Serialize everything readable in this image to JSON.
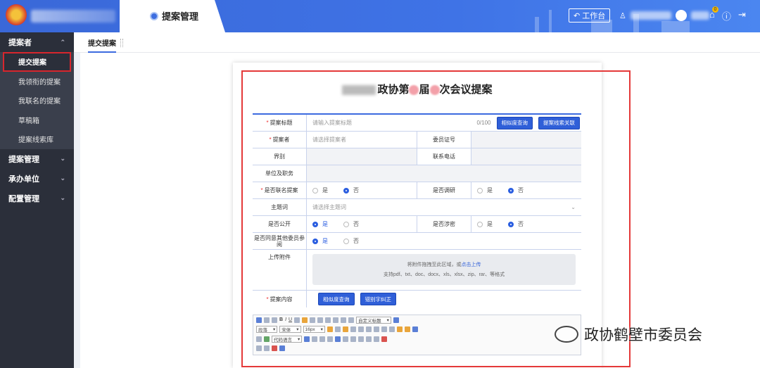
{
  "header": {
    "module_title": "提案管理",
    "workbench_label": "工作台",
    "notification_count": "0"
  },
  "sidebar": {
    "groups": [
      {
        "label": "提案者",
        "items": [
          "提交提案",
          "我领衔的提案",
          "我联名的提案",
          "草稿箱",
          "提案线索库"
        ]
      },
      {
        "label": "提案管理"
      },
      {
        "label": "承办单位"
      },
      {
        "label": "配置管理"
      }
    ]
  },
  "tabs": [
    "提交提案"
  ],
  "form": {
    "title_mid": "政协第",
    "title_mid2": "届",
    "title_end": "次会议提案",
    "fields": {
      "title_label": "提案标题",
      "title_placeholder": "请输入提案标题",
      "title_count": "0/100",
      "btn_similar": "相似度查询",
      "btn_clue": "提案线索关联",
      "proposer_label": "提案者",
      "proposer_placeholder": "请选择提案者",
      "member_no_label": "委员证号",
      "sector_label": "界别",
      "phone_label": "联系电话",
      "unit_label": "单位及职务",
      "joint_label": "是否联名提案",
      "research_label": "是否调研",
      "yes": "是",
      "no": "否",
      "topic_label": "主题词",
      "topic_placeholder": "请选择主题词",
      "public_label": "是否公开",
      "secret_label": "是否涉密",
      "agree_label": "是否同意其他委员参阅",
      "upload_label": "上传附件",
      "upload_text": "将附件拖拽至此区域，或",
      "upload_link": "点击上传",
      "upload_hint": "支持pdf、txt、doc、docx、xls、xlsx、zip、rar、等格式",
      "content_label": "提案内容",
      "btn_typo": "错别字纠正"
    },
    "editor": {
      "para": "段落",
      "font": "宋体",
      "size": "16px",
      "custom": "自定义标题",
      "code": "代码语言"
    }
  },
  "watermark": "政协鹤壁市委员会"
}
